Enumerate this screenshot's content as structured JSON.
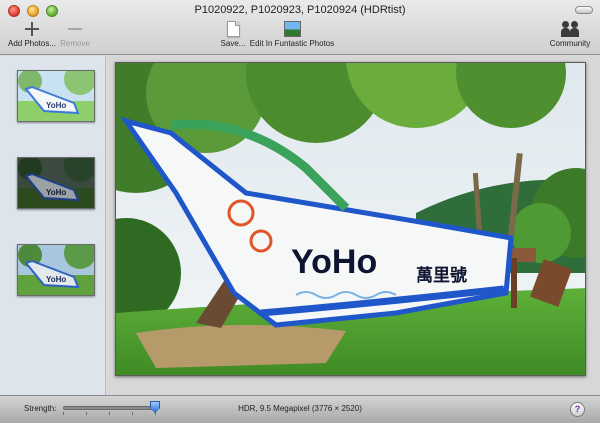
{
  "window": {
    "title": "P1020922, P1020923, P1020924 (HDRtist)"
  },
  "toolbar": {
    "add_label": "Add Photos...",
    "remove_label": "Remove",
    "save_label": "Save...",
    "edit_label": "Edit In Funtastic Photos",
    "community_label": "Community"
  },
  "icons": {
    "add": "plus-icon",
    "remove": "minus-icon",
    "save": "document-icon",
    "edit": "photo-icon",
    "community": "people-icon",
    "help": "help-icon"
  },
  "sidebar": {
    "thumbnails": [
      {
        "exposure": "over"
      },
      {
        "exposure": "under"
      },
      {
        "exposure": "normal"
      }
    ]
  },
  "photo": {
    "boat_text_main": "YoHo",
    "boat_text_cjk": "萬里號"
  },
  "statusbar": {
    "strength_label": "Strength:",
    "strength_value": 1.0,
    "info_text": "HDR, 9.5 Megapixel (3776 × 2520)",
    "help_label": "?"
  },
  "colors": {
    "accent": "#2e6fd2",
    "sidebar_bg": "#dde4ec"
  }
}
